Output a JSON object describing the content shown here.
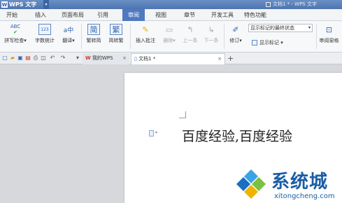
{
  "app": {
    "name": "WPS 文字",
    "window_title": "文档1 * - WPS 文字"
  },
  "menu_tabs": [
    "开始",
    "插入",
    "页面布局",
    "引用",
    "审阅",
    "视图",
    "章节",
    "开发工具",
    "特色功能"
  ],
  "active_tab": "审阅",
  "ribbon": {
    "spellcheck": "拼写检查",
    "word_count": "字数统计",
    "translate": "翻译",
    "trad_to_simp": "繁转简",
    "simp_to_trad": "简转繁",
    "insert_comment": "插入批注",
    "delete": "删除",
    "previous": "上一条",
    "next": "下一条",
    "track_changes": "修订",
    "markup_select": "显示标记的最终状态",
    "show_markup": "显示标记",
    "review_pane": "审阅窗格",
    "abc_label": "ABC",
    "num_label": "123",
    "abc2_label": "ABC"
  },
  "doc_tabs": {
    "my_wps": "我的WPS",
    "doc1": "文档1 *"
  },
  "document": {
    "text": "百度经验,百度经验"
  },
  "watermark": {
    "name": "系统城",
    "url": "xitongcheng.com"
  },
  "colors": {
    "accent": "#4f7ac0",
    "brand": "#1a5ea6"
  }
}
